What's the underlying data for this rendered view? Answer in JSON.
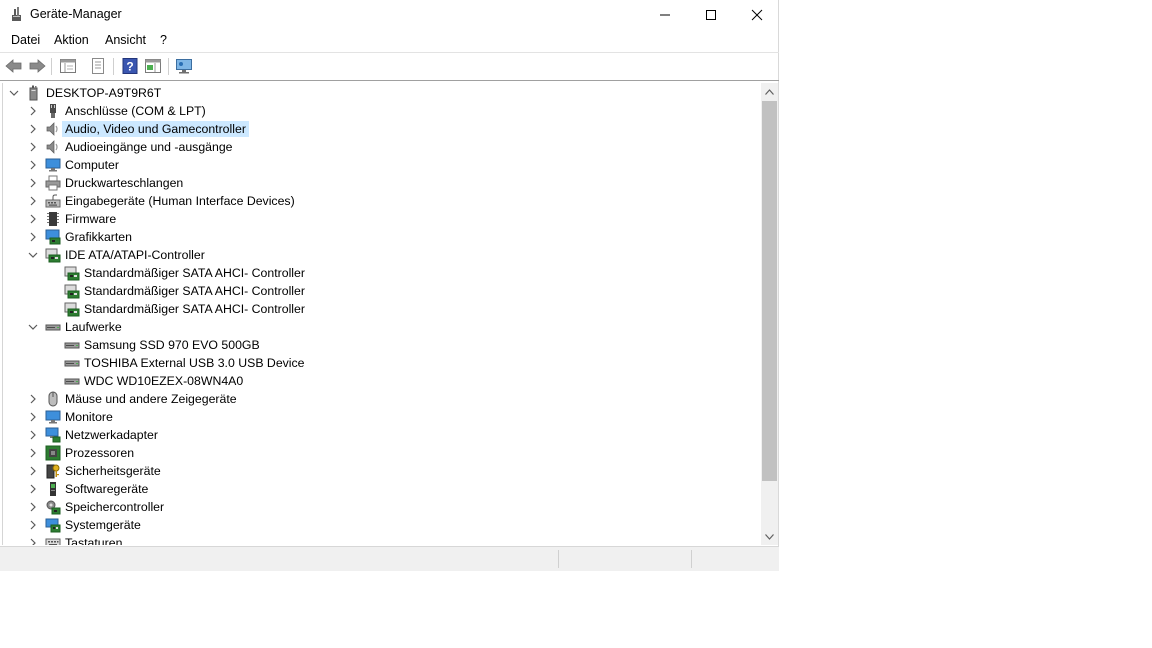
{
  "window": {
    "title": "Geräte-Manager",
    "controls": {
      "minimize": "minimize-icon",
      "maximize": "maximize-icon",
      "close": "close-icon"
    }
  },
  "menu": {
    "items": [
      {
        "label": "Datei"
      },
      {
        "label": "Aktion"
      },
      {
        "label": "Ansicht"
      },
      {
        "label": "?"
      }
    ]
  },
  "toolbar": {
    "buttons": [
      "back-arrow-icon",
      "forward-arrow-icon",
      "show-hide-console-tree-icon",
      "properties-icon",
      "help-icon",
      "action-pane-icon",
      "scan-hardware-icon"
    ]
  },
  "tree": {
    "root": {
      "label": "DESKTOP-A9T9R6T",
      "icon": "computer-tower-icon",
      "expanded": true
    },
    "nodes": [
      {
        "label": "Anschlüsse (COM & LPT)",
        "icon": "port-icon",
        "expanded": false
      },
      {
        "label": "Audio, Video und Gamecontroller",
        "icon": "speaker-icon",
        "expanded": false,
        "selected": true
      },
      {
        "label": "Audioeingänge und -ausgänge",
        "icon": "speaker-icon",
        "expanded": false
      },
      {
        "label": "Computer",
        "icon": "monitor-icon",
        "expanded": false
      },
      {
        "label": "Druckwarteschlangen",
        "icon": "printer-icon",
        "expanded": false
      },
      {
        "label": "Eingabegeräte (Human Interface Devices)",
        "icon": "hid-icon",
        "expanded": false
      },
      {
        "label": "Firmware",
        "icon": "chip-icon",
        "expanded": false
      },
      {
        "label": "Grafikkarten",
        "icon": "display-adapter-icon",
        "expanded": false
      },
      {
        "label": "IDE ATA/ATAPI-Controller",
        "icon": "controller-icon",
        "expanded": true,
        "children": [
          {
            "label": "Standardmäßiger SATA AHCI- Controller",
            "icon": "controller-icon"
          },
          {
            "label": "Standardmäßiger SATA AHCI- Controller",
            "icon": "controller-icon"
          },
          {
            "label": "Standardmäßiger SATA AHCI- Controller",
            "icon": "controller-icon"
          }
        ]
      },
      {
        "label": "Laufwerke",
        "icon": "disk-drive-icon",
        "expanded": true,
        "children": [
          {
            "label": "Samsung SSD 970 EVO 500GB",
            "icon": "disk-drive-icon"
          },
          {
            "label": "TOSHIBA External USB 3.0 USB Device",
            "icon": "disk-drive-icon"
          },
          {
            "label": "WDC WD10EZEX-08WN4A0",
            "icon": "disk-drive-icon"
          }
        ]
      },
      {
        "label": "Mäuse und andere Zeigegeräte",
        "icon": "mouse-icon",
        "expanded": false
      },
      {
        "label": "Monitore",
        "icon": "monitor-icon",
        "expanded": false
      },
      {
        "label": "Netzwerkadapter",
        "icon": "network-adapter-icon",
        "expanded": false
      },
      {
        "label": "Prozessoren",
        "icon": "processor-icon",
        "expanded": false
      },
      {
        "label": "Sicherheitsgeräte",
        "icon": "security-key-icon",
        "expanded": false
      },
      {
        "label": "Softwaregeräte",
        "icon": "software-device-icon",
        "expanded": false
      },
      {
        "label": "Speichercontroller",
        "icon": "storage-controller-icon",
        "expanded": false
      },
      {
        "label": "Systemgeräte",
        "icon": "system-devices-icon",
        "expanded": false
      },
      {
        "label": "Tastaturen",
        "icon": "keyboard-icon",
        "expanded": false
      }
    ]
  },
  "colors": {
    "selection": "#cce8ff",
    "scroll_track": "#f0f0f0",
    "scroll_thumb": "#c1c1c1"
  }
}
